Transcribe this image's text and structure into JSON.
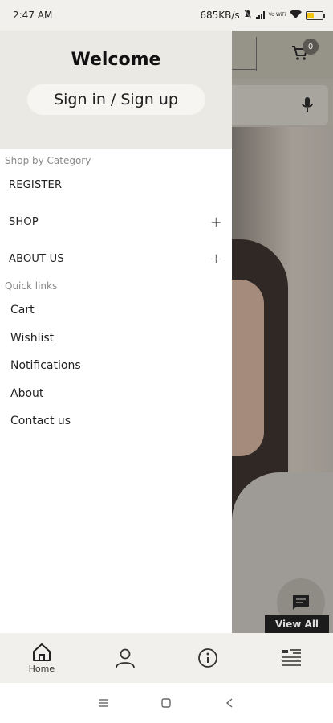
{
  "status_bar": {
    "time": "2:47 AM",
    "network_speed": "685KB/s",
    "vowifi_label": "Vo WiFi",
    "battery_icon": "battery-icon",
    "battery_level": 0.45,
    "battery_color": "#f1c40f"
  },
  "drawer": {
    "welcome": "Welcome",
    "signin_label": "Sign in / Sign up",
    "category_section": "Shop by Category",
    "categories": [
      {
        "label": "REGISTER",
        "expandable": false
      },
      {
        "label": "SHOP",
        "expandable": true,
        "expand_symbol": "+"
      },
      {
        "label": "ABOUT US",
        "expandable": true,
        "expand_symbol": "+"
      }
    ],
    "quick_section": "Quick links",
    "quick_links": [
      "Cart",
      "Wishlist",
      "Notifications",
      "About",
      "Contact us"
    ]
  },
  "background": {
    "cart_count": "0",
    "view_all_label": "View All"
  },
  "bottom_nav": {
    "items": [
      {
        "icon": "home-icon",
        "label": "Home"
      },
      {
        "icon": "profile-icon",
        "label": ""
      },
      {
        "icon": "info-icon",
        "label": ""
      },
      {
        "icon": "menu-list-icon",
        "label": ""
      }
    ]
  },
  "system_nav": {
    "icons": [
      "recents-icon",
      "home-square-icon",
      "back-icon"
    ]
  }
}
